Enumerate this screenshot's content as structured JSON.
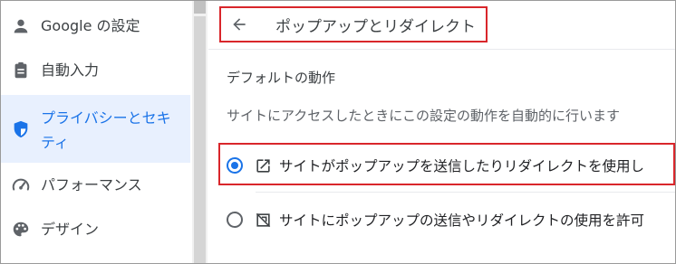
{
  "sidebar": {
    "items": [
      {
        "label": "Google の設定",
        "icon": "person-icon",
        "selected": false
      },
      {
        "label": "自動入力",
        "icon": "clipboard-icon",
        "selected": false
      },
      {
        "label": "プライバシーとセキュリティ",
        "label_line1": "プライバシーとセキ",
        "label_line2": "ティ",
        "icon": "shield-icon",
        "selected": true
      },
      {
        "label": "パフォーマンス",
        "icon": "speedometer-icon",
        "selected": false
      },
      {
        "label": "デザイン",
        "icon": "palette-icon",
        "selected": false
      }
    ]
  },
  "header": {
    "title": "ポップアップとリダイレクト",
    "back_icon": "arrow-back-icon"
  },
  "main": {
    "section_title": "デフォルトの動作",
    "description": "サイトにアクセスしたときにこの設定の動作を自動的に行います",
    "options": [
      {
        "label": "サイトがポップアップを送信したりリダイレクトを使用し",
        "icon": "open-in-new-icon",
        "checked": true
      },
      {
        "label": "サイトにポップアップの送信やリダイレクトの使用を許可",
        "icon": "popup-blocked-icon",
        "checked": false
      }
    ]
  },
  "colors": {
    "accent": "#1a73e8",
    "selected_bg": "#e8f0fe",
    "highlight_border": "#d9262b",
    "text_primary": "#202124",
    "text_secondary": "#5f6368"
  }
}
